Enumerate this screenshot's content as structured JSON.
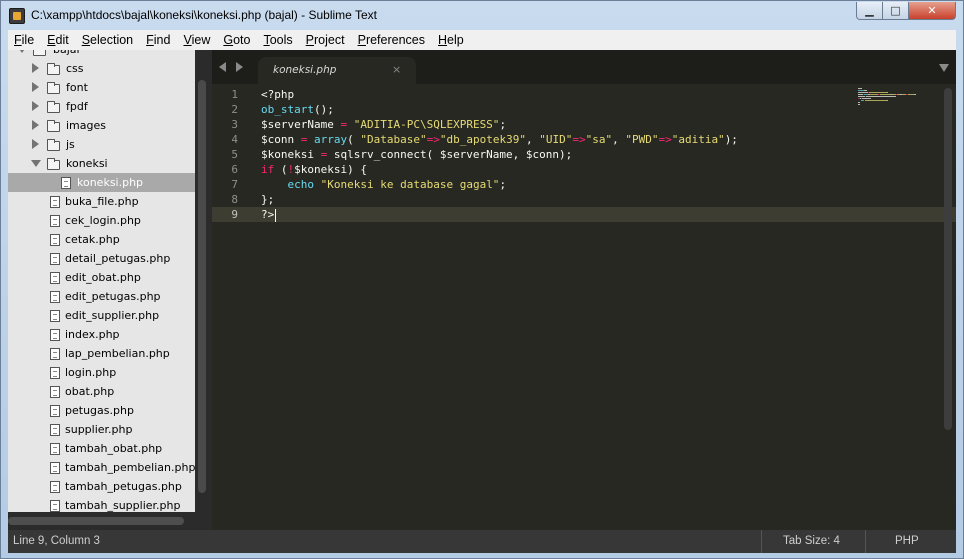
{
  "window": {
    "title": "C:\\xampp\\htdocs\\bajal\\koneksi\\koneksi.php (bajal) - Sublime Text",
    "min_glyph": "▁",
    "max_glyph": "□",
    "close_glyph": "✕"
  },
  "menu": [
    "File",
    "Edit",
    "Selection",
    "Find",
    "View",
    "Goto",
    "Tools",
    "Project",
    "Preferences",
    "Help"
  ],
  "sidebar": {
    "root": "bajal",
    "items": [
      {
        "label": "css",
        "type": "folder",
        "state": "closed"
      },
      {
        "label": "font",
        "type": "folder",
        "state": "closed"
      },
      {
        "label": "fpdf",
        "type": "folder",
        "state": "closed"
      },
      {
        "label": "images",
        "type": "folder",
        "state": "closed"
      },
      {
        "label": "js",
        "type": "folder",
        "state": "closed"
      },
      {
        "label": "koneksi",
        "type": "folder",
        "state": "open"
      },
      {
        "label": "koneksi.php",
        "type": "file",
        "selected": true,
        "nested": true
      },
      {
        "label": "buka_file.php",
        "type": "file"
      },
      {
        "label": "cek_login.php",
        "type": "file"
      },
      {
        "label": "cetak.php",
        "type": "file"
      },
      {
        "label": "detail_petugas.php",
        "type": "file"
      },
      {
        "label": "edit_obat.php",
        "type": "file"
      },
      {
        "label": "edit_petugas.php",
        "type": "file"
      },
      {
        "label": "edit_supplier.php",
        "type": "file"
      },
      {
        "label": "index.php",
        "type": "file"
      },
      {
        "label": "lap_pembelian.php",
        "type": "file"
      },
      {
        "label": "login.php",
        "type": "file"
      },
      {
        "label": "obat.php",
        "type": "file"
      },
      {
        "label": "petugas.php",
        "type": "file"
      },
      {
        "label": "supplier.php",
        "type": "file"
      },
      {
        "label": "tambah_obat.php",
        "type": "file"
      },
      {
        "label": "tambah_pembelian.php",
        "type": "file"
      },
      {
        "label": "tambah_petugas.php",
        "type": "file"
      },
      {
        "label": "tambah_supplier.php",
        "type": "file"
      }
    ]
  },
  "tab": {
    "label": "koneksi.php",
    "close": "×"
  },
  "code": {
    "current_line": 9,
    "lines": [
      [
        {
          "t": "<?php",
          "c": "v"
        }
      ],
      [
        {
          "t": "ob_start",
          "c": "f"
        },
        {
          "t": "();",
          "c": "v"
        }
      ],
      [
        {
          "t": "$serverName ",
          "c": "v"
        },
        {
          "t": "=",
          "c": "k"
        },
        {
          "t": " ",
          "c": "v"
        },
        {
          "t": "\"ADITIA-PC\\SQLEXPRESS\"",
          "c": "s"
        },
        {
          "t": ";",
          "c": "v"
        }
      ],
      [
        {
          "t": "$conn ",
          "c": "v"
        },
        {
          "t": "=",
          "c": "k"
        },
        {
          "t": " ",
          "c": "v"
        },
        {
          "t": "array",
          "c": "f"
        },
        {
          "t": "( ",
          "c": "v"
        },
        {
          "t": "\"Database\"",
          "c": "s"
        },
        {
          "t": "=>",
          "c": "k"
        },
        {
          "t": "\"db_apotek39\"",
          "c": "s"
        },
        {
          "t": ", ",
          "c": "v"
        },
        {
          "t": "\"UID\"",
          "c": "s"
        },
        {
          "t": "=>",
          "c": "k"
        },
        {
          "t": "\"sa\"",
          "c": "s"
        },
        {
          "t": ", ",
          "c": "v"
        },
        {
          "t": "\"PWD\"",
          "c": "s"
        },
        {
          "t": "=>",
          "c": "k"
        },
        {
          "t": "\"aditia\"",
          "c": "s"
        },
        {
          "t": ");",
          "c": "v"
        }
      ],
      [
        {
          "t": "$koneksi ",
          "c": "v"
        },
        {
          "t": "=",
          "c": "k"
        },
        {
          "t": " sqlsrv_connect( $serverName, $conn);",
          "c": "v"
        }
      ],
      [
        {
          "t": "if",
          "c": "k"
        },
        {
          "t": " (",
          "c": "v"
        },
        {
          "t": "!",
          "c": "k"
        },
        {
          "t": "$koneksi) {",
          "c": "v"
        }
      ],
      [
        {
          "t": "    ",
          "c": "v"
        },
        {
          "t": "echo",
          "c": "f"
        },
        {
          "t": " ",
          "c": "v"
        },
        {
          "t": "\"Koneksi ke database gagal\"",
          "c": "s"
        },
        {
          "t": ";",
          "c": "v"
        }
      ],
      [
        {
          "t": "};",
          "c": "v"
        }
      ],
      [
        {
          "t": "?>",
          "c": "v"
        }
      ]
    ]
  },
  "status": {
    "position": "Line 9, Column 3",
    "tab_size": "Tab Size: 4",
    "syntax": "PHP"
  },
  "colors": {
    "editor_bg": "#272822",
    "keyword": "#f92672",
    "string": "#e6db74",
    "function": "#66d9ef",
    "text": "#f8f8f2"
  }
}
